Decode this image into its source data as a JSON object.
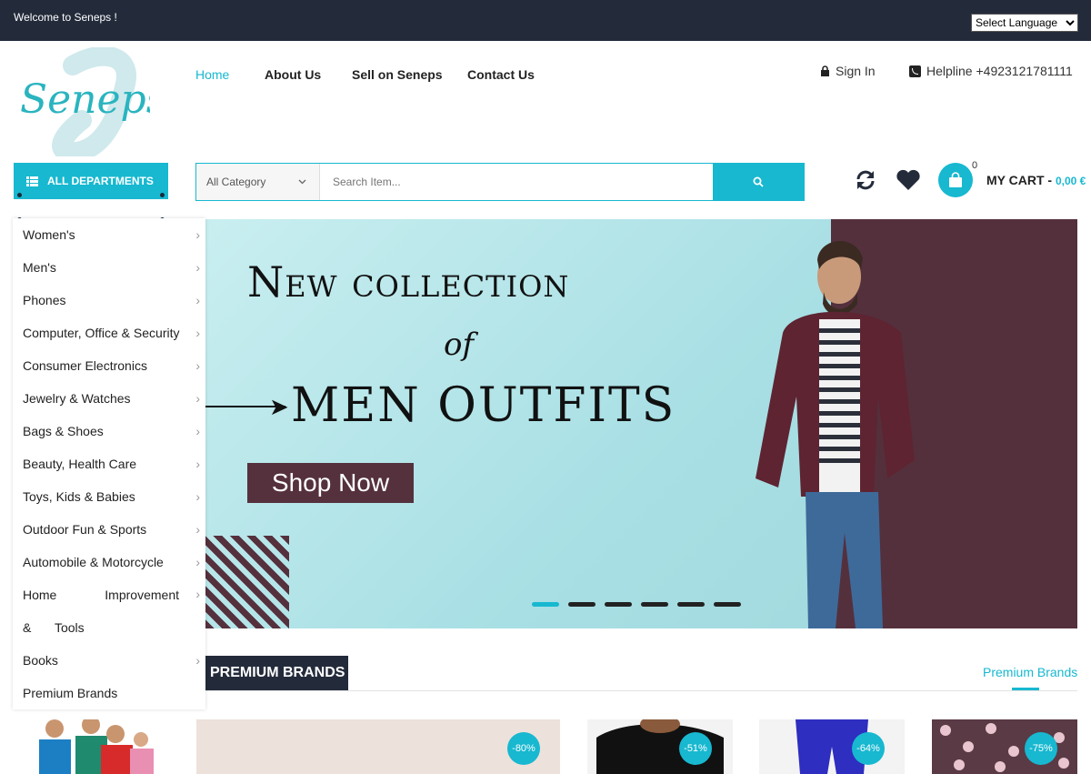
{
  "topbar": {
    "welcome": "Welcome to Seneps !",
    "language_select": "Select Language"
  },
  "logo": {
    "text": "Seneps"
  },
  "nav": {
    "items": [
      {
        "label": "Home",
        "active": true
      },
      {
        "label": "About Us"
      },
      {
        "label": "Sell on Seneps"
      },
      {
        "label": "Contact Us"
      }
    ]
  },
  "account": {
    "signin": "Sign In",
    "helpline": "Helpline +4923121781111"
  },
  "departments": {
    "button_label": "ALL DEPARTMENTS",
    "items": [
      "Women's",
      "Men's",
      "Phones",
      "Computer, Office & Security",
      "Consumer Electronics",
      "Jewelry & Watches",
      "Bags & Shoes",
      "Beauty, Health Care",
      "Toys, Kids & Babies",
      "Outdoor Fun & Sports",
      "Automobile & Motorcycle",
      "Home Improvement & Tools",
      "Books",
      "Premium Brands"
    ]
  },
  "search": {
    "category": "All Category",
    "placeholder": "Search Item..."
  },
  "cart": {
    "count": "0",
    "label": "MY CART - ",
    "amount": "0,00 €"
  },
  "banner": {
    "title_line1": "New collection",
    "title_of": "of",
    "title_line2": "MEN OUTFITS",
    "cta": "Shop Now",
    "slides": 6,
    "active_slide": 1
  },
  "brands_section": {
    "heading": "PREMIUM BRANDS",
    "tab": "Premium Brands"
  },
  "products": [
    {
      "discount": "-80%"
    },
    {
      "discount": "-51%"
    },
    {
      "discount": "-64%"
    },
    {
      "discount": "-75%"
    }
  ],
  "colors": {
    "accent": "#17b8d0",
    "dark": "#232b3b",
    "maroon": "#55313d"
  }
}
